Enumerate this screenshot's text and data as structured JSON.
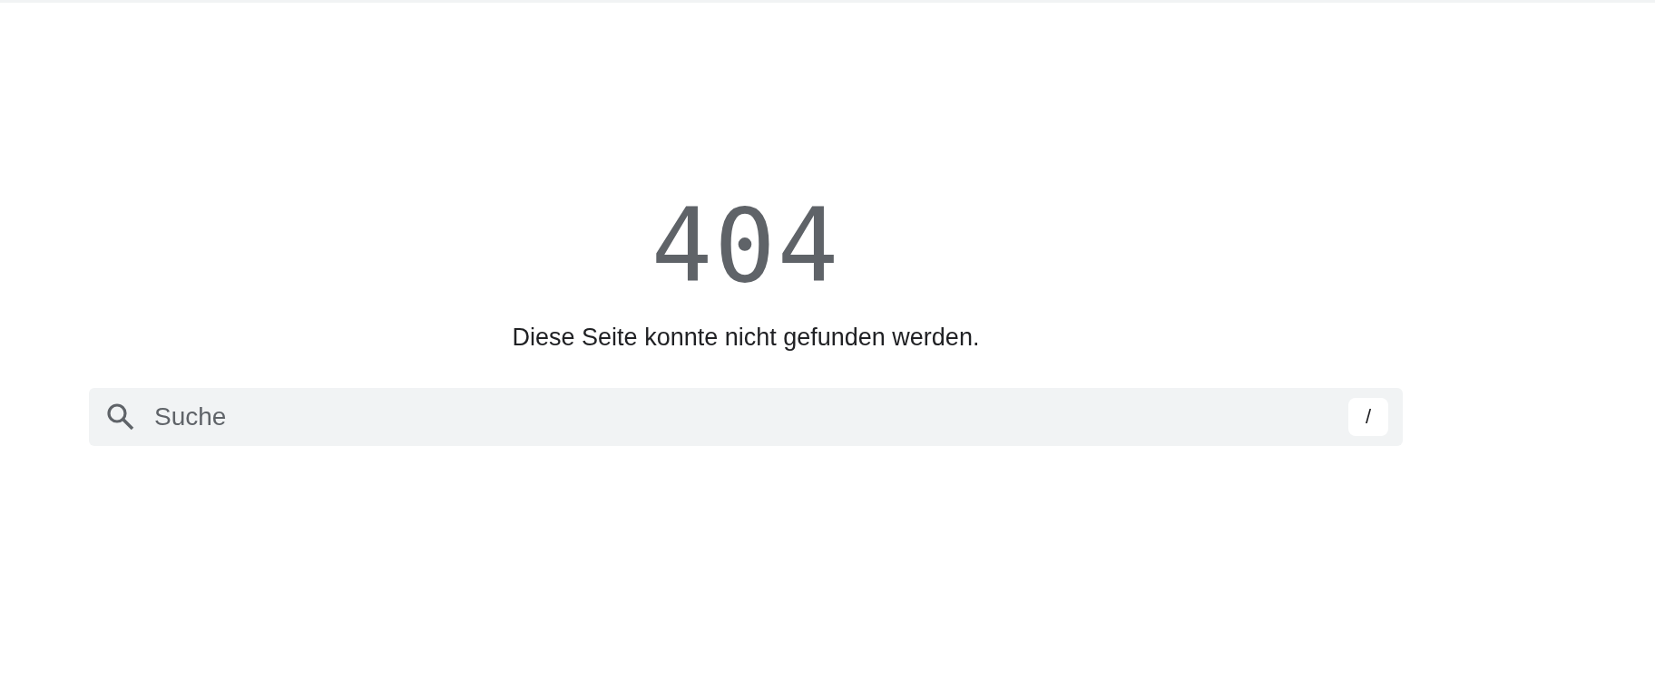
{
  "error_code": "404",
  "message": "Diese Seite konnte nicht gefunden werden.",
  "search": {
    "placeholder": "Suche",
    "shortcut": "/"
  }
}
